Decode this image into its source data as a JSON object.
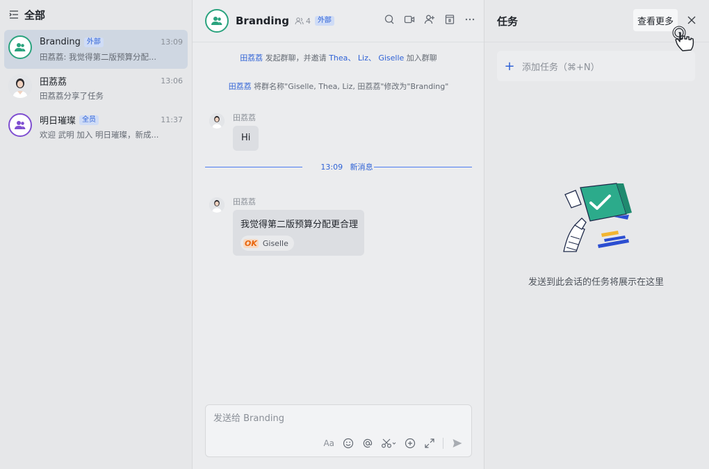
{
  "sidebar": {
    "title": "全部",
    "conversations": [
      {
        "name": "Branding",
        "badge": "外部",
        "time": "13:09",
        "preview": "田荔荔: 我觉得第二版预算分配...",
        "avatar": "group-icon"
      },
      {
        "name": "田荔荔",
        "badge": "",
        "time": "13:06",
        "preview": "田荔荔分享了任务",
        "avatar": "person-avatar"
      },
      {
        "name": "明日璀璨",
        "badge": "全员",
        "time": "11:37",
        "preview": "欢迎 武明 加入 明日璀璨，新成...",
        "avatar": "group-icon"
      }
    ]
  },
  "chat": {
    "title": "Branding",
    "member_count": "4",
    "badge": "外部",
    "system_messages": [
      {
        "actor": "田荔荔",
        "text1": " 发起群聊，并邀请 ",
        "names": "Thea、 Liz、 Giselle",
        "text2": " 加入群聊"
      },
      {
        "actor": "田荔荔",
        "text": " 将群名称\"Giselle, Thea, Liz, 田荔荔\"修改为\"Branding\""
      }
    ],
    "messages": [
      {
        "sender": "田荔荔",
        "text": "Hi"
      },
      {
        "sender": "田荔荔",
        "text": "我觉得第二版预算分配更合理",
        "reaction_label": "OK",
        "reaction_user": "Giselle"
      }
    ],
    "divider": {
      "time": "13:09",
      "label": "新消息"
    },
    "composer": {
      "placeholder": "发送给 Branding",
      "font_label": "Aa"
    }
  },
  "tasks": {
    "title": "任务",
    "more_label": "查看更多",
    "add_task_label": "添加任务（⌘+N）",
    "empty_text": "发送到此会话的任务将展示在这里"
  },
  "colors": {
    "accent": "#2f62d6",
    "group_avatar_green": "#2aa37e",
    "group_avatar_purple": "#7f4fd1",
    "new_message_line": "#4b7cf0"
  }
}
